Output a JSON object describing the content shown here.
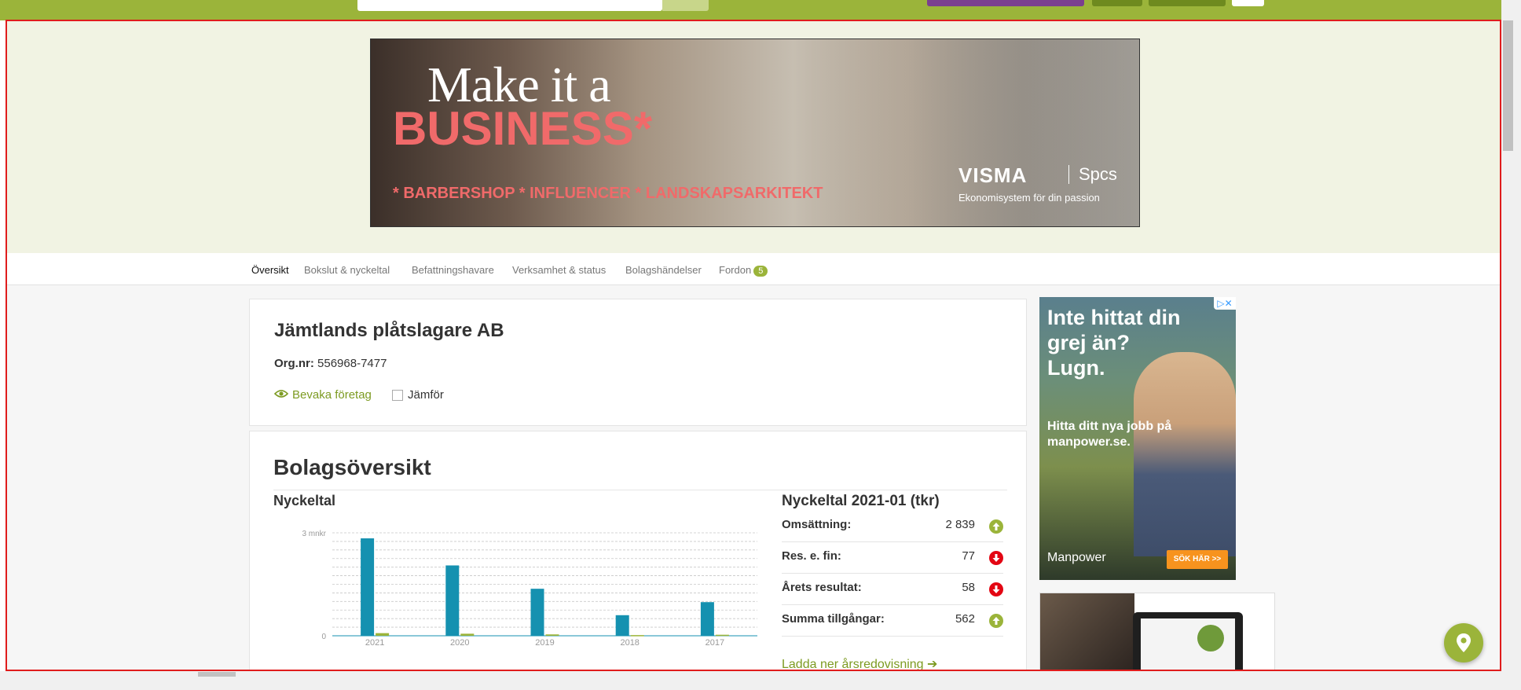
{
  "banner": {
    "headline_1": "Make it a",
    "headline_2": "BUSINESS*",
    "tagline": "* BARBERSHOP  * INFLUENCER  * LANDSKAPSARKITEKT",
    "brand": "VISMA",
    "brand_sub": "Spcs",
    "brand_caption": "Ekonomisystem för din passion"
  },
  "tabs": [
    {
      "label": "Översikt",
      "active": true
    },
    {
      "label": "Bokslut & nyckeltal"
    },
    {
      "label": "Befattningshavare"
    },
    {
      "label": "Verksamhet & status"
    },
    {
      "label": "Bolagshändelser"
    },
    {
      "label": "Fordon",
      "badge": "5"
    }
  ],
  "company": {
    "name": "Jämtlands plåtslagare AB",
    "org_label": "Org.nr:",
    "org_number": "556968-7477",
    "watch_label": "Bevaka företag",
    "compare_label": "Jämför"
  },
  "overview": {
    "title": "Bolagsöversikt",
    "chart_heading": "Nyckeltal"
  },
  "chart_data": {
    "type": "bar",
    "categories": [
      "2021",
      "2020",
      "2019",
      "2018",
      "2017"
    ],
    "series": [
      {
        "values": [
          2.839,
          2.05,
          1.37,
          0.6,
          0.98
        ],
        "color": "#1591b0"
      },
      {
        "values": [
          0.077,
          0.06,
          0.04,
          0.02,
          0.03
        ],
        "color": "#9bb43a"
      }
    ],
    "ytick_labels": [
      "3 mnkr",
      "0"
    ],
    "ylim": [
      0,
      3
    ]
  },
  "key_figures": {
    "title": "Nyckeltal 2021-01 (tkr)",
    "rows": [
      {
        "label": "Omsättning:",
        "value": "2 839",
        "trend": "up"
      },
      {
        "label": "Res. e. fin:",
        "value": "77",
        "trend": "down"
      },
      {
        "label": "Årets resultat:",
        "value": "58",
        "trend": "down"
      },
      {
        "label": "Summa tillgångar:",
        "value": "562",
        "trend": "up"
      }
    ],
    "download_label": "Ladda ner årsredovisning"
  },
  "side_ad": {
    "headline": "Inte hittat din grej än? Lugn.",
    "body": "Hitta ditt nya jobb på manpower.se.",
    "brand": "Manpower",
    "cta": "SÖK HÄR >>"
  },
  "colors": {
    "brand_green": "#9bb43a",
    "bar_primary": "#1591b0",
    "trend_up": "#9bb43a",
    "trend_down": "#e30613",
    "frame_border": "#e01c1c"
  }
}
